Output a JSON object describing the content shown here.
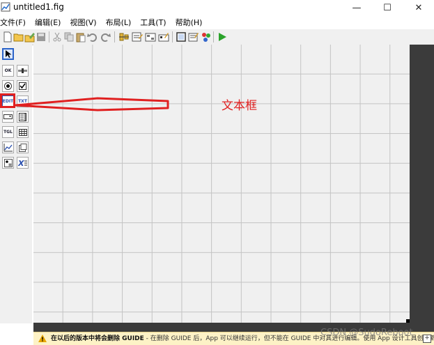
{
  "window": {
    "title": "untitled1.fig",
    "minimize_glyph": "—",
    "maximize_glyph": "☐",
    "close_glyph": "✕"
  },
  "menu": [
    "文件(F)",
    "编辑(E)",
    "视图(V)",
    "布局(L)",
    "工具(T)",
    "帮助(H)"
  ],
  "toolbar": {
    "icons": [
      "new-icon",
      "open-icon",
      "edit-icon",
      "save-icon",
      "cut-icon",
      "copy-icon",
      "paste-icon",
      "undo-icon",
      "redo-icon",
      "align-icon",
      "menu-editor-icon",
      "tab-order-icon",
      "toolbar-editor-icon",
      "editor-icon",
      "property-inspector-icon",
      "object-browser-icon",
      "run-icon"
    ]
  },
  "palette": {
    "selected": "select-tool",
    "items": [
      "select-tool",
      "push-button-tool",
      "slider-tool",
      "radio-button-tool",
      "checkbox-tool",
      "edit-text-tool",
      "static-text-tool",
      "popup-menu-tool",
      "listbox-tool",
      "toggle-button-tool",
      "table-tool",
      "axes-tool",
      "panel-tool",
      "button-group-tool",
      "activex-tool"
    ],
    "labels": {
      "push": "OK",
      "edit": "EDIT",
      "static": "TXT",
      "toggle": "TGL"
    }
  },
  "annotation": {
    "label": "文本框",
    "color": "#e02020"
  },
  "warning": {
    "bold_text": "在以后的版本中将会删除 GUIDE",
    "text": " - 在删除 GUIDE 后，App 可以继续运行，但不能在 GUIDE 中对其进行编辑。使用 App 设计工具创建新 App。",
    "expand_glyph": "+"
  },
  "watermark": "CSDN @SudoReboot"
}
